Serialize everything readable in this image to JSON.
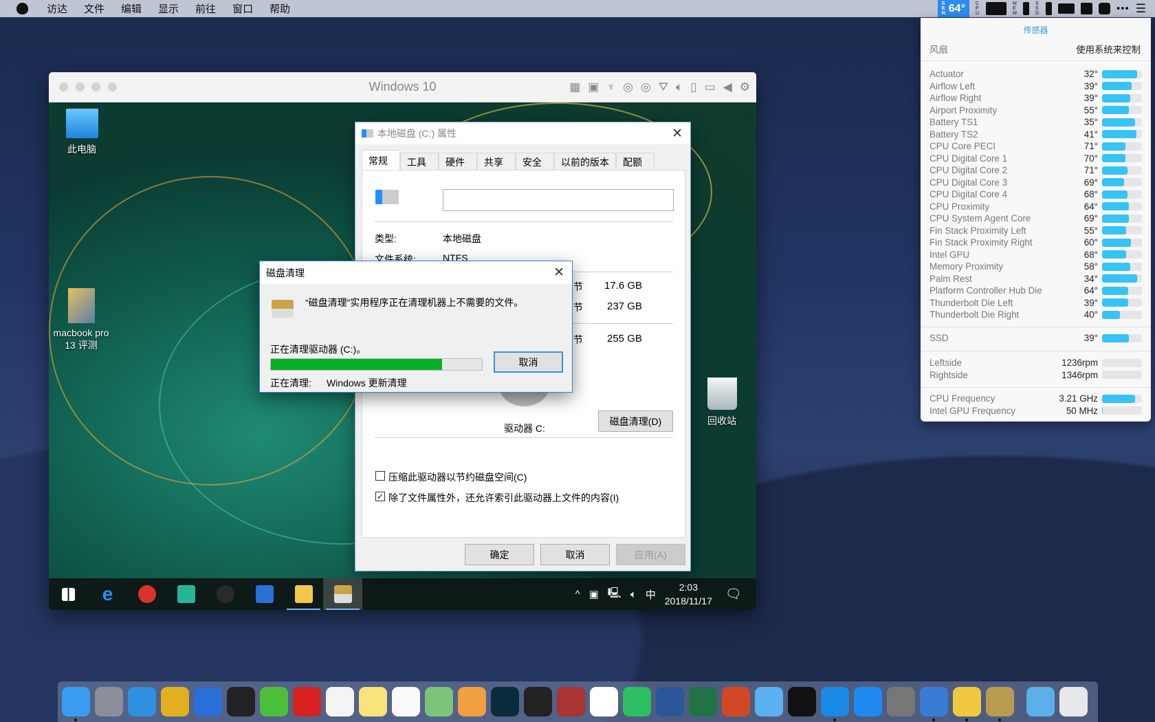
{
  "menubar": {
    "items": [
      "访达",
      "文件",
      "编辑",
      "显示",
      "前往",
      "窗口",
      "帮助"
    ],
    "sensor_label": "SEN",
    "temperature": "64°",
    "cpu_label": "CPU",
    "mem_label": "MEM",
    "ssd_label": "SSD"
  },
  "vm": {
    "title": "Windows 10"
  },
  "desktop_icons": {
    "this_pc": "此电脑",
    "folder": "macbook pro 13 评测",
    "recycle": "回收站"
  },
  "properties": {
    "title": "本地磁盘 (C:) 属性",
    "tabs": [
      "常规",
      "工具",
      "硬件",
      "共享",
      "安全",
      "以前的版本",
      "配额"
    ],
    "selected_tab": "常规",
    "name_value": "",
    "type_label": "类型:",
    "type_value": "本地磁盘",
    "fs_label": "文件系统:",
    "fs_value": "NTFS",
    "bytes_suffix": "节",
    "used": "17.6 GB",
    "free": "237 GB",
    "capacity": "255 GB",
    "drive_label": "驱动器 C:",
    "cleanup_button": "磁盘清理(D)",
    "compress_label": "压缩此驱动器以节约磁盘空间(C)",
    "compress_checked": false,
    "index_label": "除了文件属性外，还允许索引此驱动器上文件的内容(I)",
    "index_checked": true,
    "ok": "确定",
    "cancel": "取消",
    "apply": "应用(A)"
  },
  "cleanup": {
    "title": "磁盘清理",
    "message": "“磁盘清理”实用程序正在清理机器上不需要的文件。",
    "drive_status": "正在清理驱动器  (C:)。",
    "progress": 0.81,
    "cancel": "取消",
    "current_label": "正在清理:",
    "current_item": "Windows 更新清理"
  },
  "taskbar": {
    "apps": [
      "start",
      "edge",
      "ccleaner",
      "app-green",
      "nx2",
      "artstudio",
      "file-explorer",
      "disk-cleanup"
    ],
    "ime": "中",
    "time": "2:03",
    "date": "2018/11/17"
  },
  "sensors": {
    "header": "传感器",
    "fan_label": "风扇",
    "fan_mode": "使用系统来控制",
    "temps": [
      {
        "name": "Actuator",
        "value": "32°",
        "level": 0.88
      },
      {
        "name": "Airflow Left",
        "value": "39°",
        "level": 0.74
      },
      {
        "name": "Airflow Right",
        "value": "39°",
        "level": 0.7
      },
      {
        "name": "Airport Proximity",
        "value": "55°",
        "level": 0.68
      },
      {
        "name": "Battery TS1",
        "value": "35°",
        "level": 0.83
      },
      {
        "name": "Battery TS2",
        "value": "41°",
        "level": 0.87
      },
      {
        "name": "CPU Core PECI",
        "value": "71°",
        "level": 0.58
      },
      {
        "name": "CPU Digital Core 1",
        "value": "70°",
        "level": 0.58
      },
      {
        "name": "CPU Digital Core 2",
        "value": "71°",
        "level": 0.63
      },
      {
        "name": "CPU Digital Core 3",
        "value": "69°",
        "level": 0.56
      },
      {
        "name": "CPU Digital Core 4",
        "value": "68°",
        "level": 0.63
      },
      {
        "name": "CPU Proximity",
        "value": "64°",
        "level": 0.68
      },
      {
        "name": "CPU System Agent Core",
        "value": "69°",
        "level": 0.68
      },
      {
        "name": "Fin Stack Proximity Left",
        "value": "55°",
        "level": 0.6
      },
      {
        "name": "Fin Stack Proximity Right",
        "value": "60°",
        "level": 0.72
      },
      {
        "name": "Intel GPU",
        "value": "68°",
        "level": 0.6
      },
      {
        "name": "Memory Proximity",
        "value": "58°",
        "level": 0.71
      },
      {
        "name": "Palm Rest",
        "value": "34°",
        "level": 0.88
      },
      {
        "name": "Platform Controller Hub Die",
        "value": "64°",
        "level": 0.66
      },
      {
        "name": "Thunderbolt Die Left",
        "value": "39°",
        "level": 0.66
      },
      {
        "name": "Thunderbolt Die Right",
        "value": "40°",
        "level": 0.45
      }
    ],
    "ssd": [
      {
        "name": "SSD",
        "value": "39°",
        "level": 0.68
      }
    ],
    "fans": [
      {
        "name": "Leftside",
        "value": "1236rpm",
        "level": 0
      },
      {
        "name": "Rightside",
        "value": "1346rpm",
        "level": 0
      }
    ],
    "freq": [
      {
        "name": "CPU Frequency",
        "value": "3.21 GHz",
        "level": 0.83
      },
      {
        "name": "Intel GPU Frequency",
        "value": "50 MHz",
        "level": 0.02
      }
    ]
  },
  "dock": {
    "apps": [
      {
        "name": "finder",
        "color": "#3a9cf0",
        "run": true
      },
      {
        "name": "launchpad",
        "color": "#8a8f99"
      },
      {
        "name": "safari",
        "color": "#2f8fe0"
      },
      {
        "name": "chrome",
        "color": "#e0b020"
      },
      {
        "name": "artstudio",
        "color": "#2a6fd6"
      },
      {
        "name": "qq",
        "color": "#222"
      },
      {
        "name": "wechat",
        "color": "#4cbf3a"
      },
      {
        "name": "mail-cn",
        "color": "#d6211e"
      },
      {
        "name": "calendar",
        "color": "#f4f4f4"
      },
      {
        "name": "notes",
        "color": "#f8e27a"
      },
      {
        "name": "reminders",
        "color": "#fafafa"
      },
      {
        "name": "maps",
        "color": "#7cc47a"
      },
      {
        "name": "photos",
        "color": "#f0a040"
      },
      {
        "name": "photoshop",
        "color": "#0b2a3c"
      },
      {
        "name": "nx2",
        "color": "#222"
      },
      {
        "name": "dictionary",
        "color": "#a33"
      },
      {
        "name": "ia-writer",
        "color": "#fff"
      },
      {
        "name": "evernote",
        "color": "#2dbe60"
      },
      {
        "name": "word",
        "color": "#2b579a"
      },
      {
        "name": "excel",
        "color": "#217346"
      },
      {
        "name": "powerpoint",
        "color": "#d24726"
      },
      {
        "name": "twitterrific",
        "color": "#5ab0f0"
      },
      {
        "name": "kiwi",
        "color": "#111"
      },
      {
        "name": "windows-vm",
        "color": "#1a8ae6",
        "run": true
      },
      {
        "name": "app-store",
        "color": "#1f8bf0"
      },
      {
        "name": "system-preferences",
        "color": "#777"
      },
      {
        "name": "preview",
        "color": "#3a7bd5",
        "run": true
      },
      {
        "name": "folder",
        "color": "#f0c840",
        "run": true
      },
      {
        "name": "disk-cleanup",
        "color": "#b89a50",
        "run": true
      },
      {
        "name": "downloads",
        "color": "#5bb0ea"
      },
      {
        "name": "trash",
        "color": "#e8e8ea"
      }
    ]
  }
}
